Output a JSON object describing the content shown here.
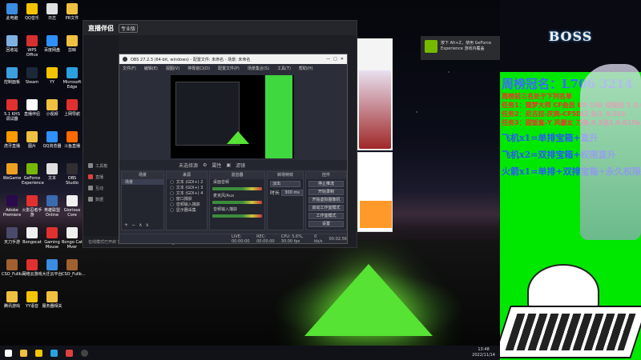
{
  "desktop": {
    "icons": [
      {
        "label": "此电脑",
        "color": "#3a8de0"
      },
      {
        "label": "QQ音乐",
        "color": "#f5c400"
      },
      {
        "label": "日志",
        "color": "#e0e0e0"
      },
      {
        "label": "PR文件",
        "color": "#f0c040"
      },
      {
        "label": "回收站",
        "color": "#7fb0e0"
      },
      {
        "label": "WPS Office",
        "color": "#d83030"
      },
      {
        "label": "百度网盘",
        "color": "#2f8fff"
      },
      {
        "label": "剪映",
        "color": "#f0c040"
      },
      {
        "label": "控制面板",
        "color": "#3aa0e0"
      },
      {
        "label": "Steam",
        "color": "#1b2838"
      },
      {
        "label": "YY",
        "color": "#f5c400"
      },
      {
        "label": "Microsoft Edge",
        "color": "#2aa0e0"
      },
      {
        "label": "5.1 KHS 调试器",
        "color": "#e03030"
      },
      {
        "label": "直播伴侣",
        "color": "#ffffff"
      },
      {
        "label": "小视频",
        "color": "#f0c040"
      },
      {
        "label": "上网导航",
        "color": "#e03030"
      },
      {
        "label": "虎牙直播",
        "color": "#ff9900"
      },
      {
        "label": "图片",
        "color": "#f0c040"
      },
      {
        "label": "QQ浏览器",
        "color": "#2f8fff"
      },
      {
        "label": "斗鱼直播",
        "color": "#ff6a00"
      },
      {
        "label": "WeGame",
        "color": "#f0a020"
      },
      {
        "label": "GeForce Experience",
        "color": "#76b900"
      },
      {
        "label": "文本",
        "color": "#e0e0e0"
      },
      {
        "label": "OBS Studio",
        "color": "#302e31"
      },
      {
        "label": "Adobe Premiere",
        "color": "#2a0a4a"
      },
      {
        "label": "火影忍者手游",
        "color": "#e03030"
      },
      {
        "label": "英雄联盟 Online",
        "color": "#3a6ab0"
      },
      {
        "label": "Glorious Core",
        "color": "#f0f0f0"
      },
      {
        "label": "天刀手游",
        "color": "#4a4a6a"
      },
      {
        "label": "Bongocat",
        "color": "#f0f0f0"
      },
      {
        "label": "Gaming Mouse",
        "color": "#e03030"
      },
      {
        "label": "Bongo Cat Mver",
        "color": "#f0f0f0"
      },
      {
        "label": "CSO_Fullb...",
        "color": "#a06030"
      },
      {
        "label": "网络云游戏",
        "color": "#e03030"
      },
      {
        "label": "大迁云平台",
        "color": "#3a8de0"
      },
      {
        "label": "CSO_Fullb...",
        "color": "#a06030"
      },
      {
        "label": "腾讯游戏",
        "color": "#f0c040"
      },
      {
        "label": "YY语音",
        "color": "#f5c400"
      },
      {
        "label": "服务器相关",
        "color": "#f0c040"
      }
    ]
  },
  "streamer_app": {
    "title": "直播伴侣",
    "badge": "专业版",
    "status_text": "在线模式已开启 实播播放量2690 2022-11-14_17-49-41.mp4",
    "sidebar": [
      {
        "label": "工具箱",
        "icon": "toolbox-icon"
      },
      {
        "label": "直播",
        "icon": "live-icon"
      },
      {
        "label": "互动",
        "icon": "chat-icon"
      },
      {
        "label": "数据",
        "icon": "chart-icon"
      }
    ]
  },
  "obs": {
    "title": "OBS 27.2.3 (64-bit, windows) - 配置文件: 未命名 - 场景: 未命名",
    "menu": [
      "文件(F)",
      "编辑(E)",
      "视图(V)",
      "停靠窗口(D)",
      "配置文件(P)",
      "场景集合(S)",
      "工具(T)",
      "帮助(H)"
    ],
    "no_source": "未选择源",
    "properties": "属性",
    "filters": "滤镜",
    "docks": {
      "scenes": {
        "title": "场景",
        "items": [
          "场景"
        ]
      },
      "sources": {
        "title": "来源",
        "items": [
          "文本 (GDI+) 2",
          "文本 (GDI+) 3",
          "文本 (GDI+) 4",
          "窗口捕获",
          "音频输入捕获",
          "显示器采集"
        ]
      },
      "mixer": {
        "title": "混音器",
        "items": [
          "桌面音频",
          "麦克风/Aux",
          "音频输入捕获"
        ]
      },
      "transitions": {
        "title": "转场特效",
        "type": "淡出",
        "duration_label": "时长",
        "duration": "300 ms"
      },
      "controls": {
        "title": "控件",
        "buttons": [
          "停止推流",
          "开始录制",
          "开始虚拟摄像机",
          "启动工作室模式",
          "工作室模式",
          "设置",
          "退出"
        ]
      }
    },
    "status": {
      "live": "LIVE: 00:00:00",
      "rec": "REC: 00:00:00",
      "cpu": "CPU: 5.6%, 30.00 fps",
      "kbps": "0 kb/s",
      "time": "00:02:56"
    }
  },
  "notification": {
    "line1": "按下 Alt+Z，使用 GeForce",
    "line2": "Experience 游戏内覆盖"
  },
  "taskbar": {
    "time": "13:48",
    "date": "2022/11/14"
  },
  "overlay": {
    "banner": "BOSS",
    "rank_title": "周榜冠名：L706 3214",
    "rank_lines": [
      "周榜前三名处于下列名单",
      "任务1：猫梦大师 CF会员 UP 100 动物连 1 0.01k",
      "任务2：尼古拉-庆典-CF5DI2 永久 0.01k",
      "任务3：甜饭盒-Y 风暴女 刀锋-X 3送1 0.015k"
    ],
    "gift_lines": [
      "飞机x1=单排宝箱+直升",
      "飞机x2=双排宝箱+权限直升",
      "火箭x1=单排+双排宝箱+永久权限直升"
    ]
  }
}
